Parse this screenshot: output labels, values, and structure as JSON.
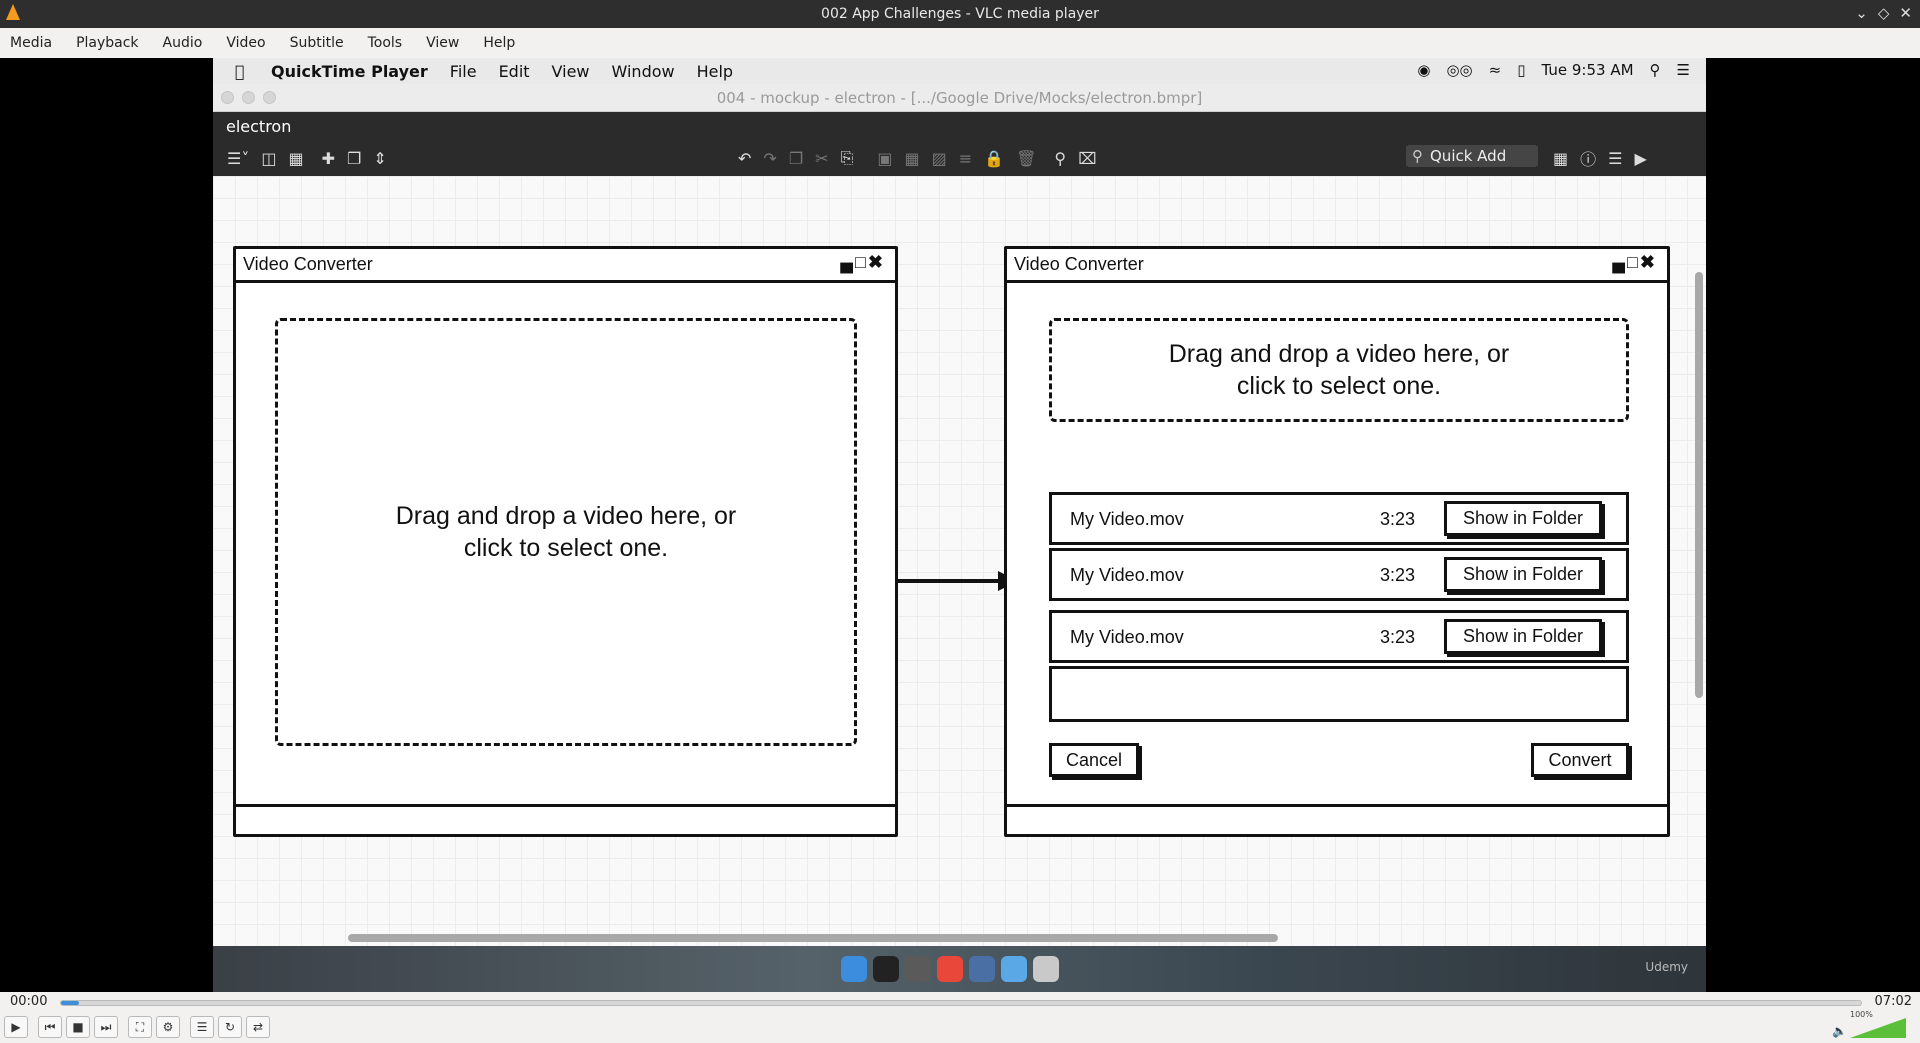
{
  "vlc": {
    "title": "002 App Challenges - VLC media player",
    "menu": [
      "Media",
      "Playback",
      "Audio",
      "Video",
      "Subtitle",
      "Tools",
      "View",
      "Help"
    ],
    "time_elapsed": "00:00",
    "time_total": "07:02",
    "volume": "100%",
    "seek_progress": 0.01
  },
  "mac_menu": {
    "app": "QuickTime Player",
    "items": [
      "File",
      "Edit",
      "View",
      "Window",
      "Help"
    ],
    "clock": "Tue 9:53 AM"
  },
  "balsamiq": {
    "window_title": "004 - mockup - electron - [.../Google Drive/Mocks/electron.bmpr]",
    "project": "electron",
    "quick_add": "Quick Add"
  },
  "mockup_left": {
    "title": "Video Converter",
    "drop_line1": "Drag and drop a video here, or",
    "drop_line2": "click to select one."
  },
  "mockup_right": {
    "title": "Video Converter",
    "drop_line1": "Drag and drop a video here, or",
    "drop_line2": "click to select one.",
    "rows": [
      {
        "name": "My Video.mov",
        "duration": "3:23",
        "action": "Show in Folder"
      },
      {
        "name": "My Video.mov",
        "duration": "3:23",
        "action": "Show in Folder"
      },
      {
        "name": "My Video.mov",
        "duration": "3:23",
        "action": "Show in Folder"
      }
    ],
    "cancel": "Cancel",
    "convert": "Convert"
  },
  "dock": {
    "watermark": "Udemy",
    "icon_colors": [
      "#3c8dde",
      "#222222",
      "#5a5a5a",
      "#e8473a",
      "#4a6fa5",
      "#5aa9e6",
      "#c9c9c9"
    ]
  },
  "colors": {
    "vlc_orange": "#f39a1f",
    "volume_green": "#5cbf3a"
  }
}
